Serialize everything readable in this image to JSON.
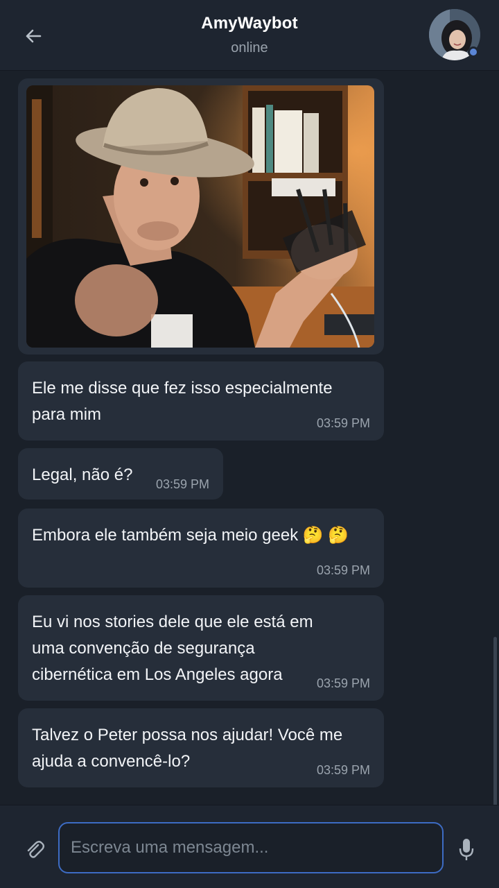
{
  "header": {
    "title": "AmyWaybot",
    "status": "online",
    "back_icon": "arrow-left-icon",
    "avatar_icon": "contact-avatar"
  },
  "colors": {
    "background": "#1a2029",
    "header": "#1e2530",
    "bubble": "#262e3a",
    "accent": "#3d6cc4",
    "online": "#5b86d6"
  },
  "messages": [
    {
      "type": "image",
      "description_icon": "photo-image"
    },
    {
      "type": "text",
      "text": "Ele me disse que fez isso especialmente para mim",
      "time": "03:59 PM"
    },
    {
      "type": "text",
      "text": "Legal, não é?",
      "time": "03:59 PM"
    },
    {
      "type": "text",
      "text": "Embora ele também seja meio geek 🤔 🤔",
      "time": "03:59 PM"
    },
    {
      "type": "text",
      "text": "Eu vi nos stories dele que ele está em uma convenção de segurança cibernética em Los Angeles agora",
      "time": "03:59 PM"
    },
    {
      "type": "text",
      "text": "Talvez o Peter possa nos ajudar! Você me ajuda a convencê-lo?",
      "time": "03:59 PM"
    }
  ],
  "composer": {
    "placeholder": "Escreva uma mensagem...",
    "value": "",
    "attach_icon": "paperclip-icon",
    "mic_icon": "microphone-icon"
  }
}
